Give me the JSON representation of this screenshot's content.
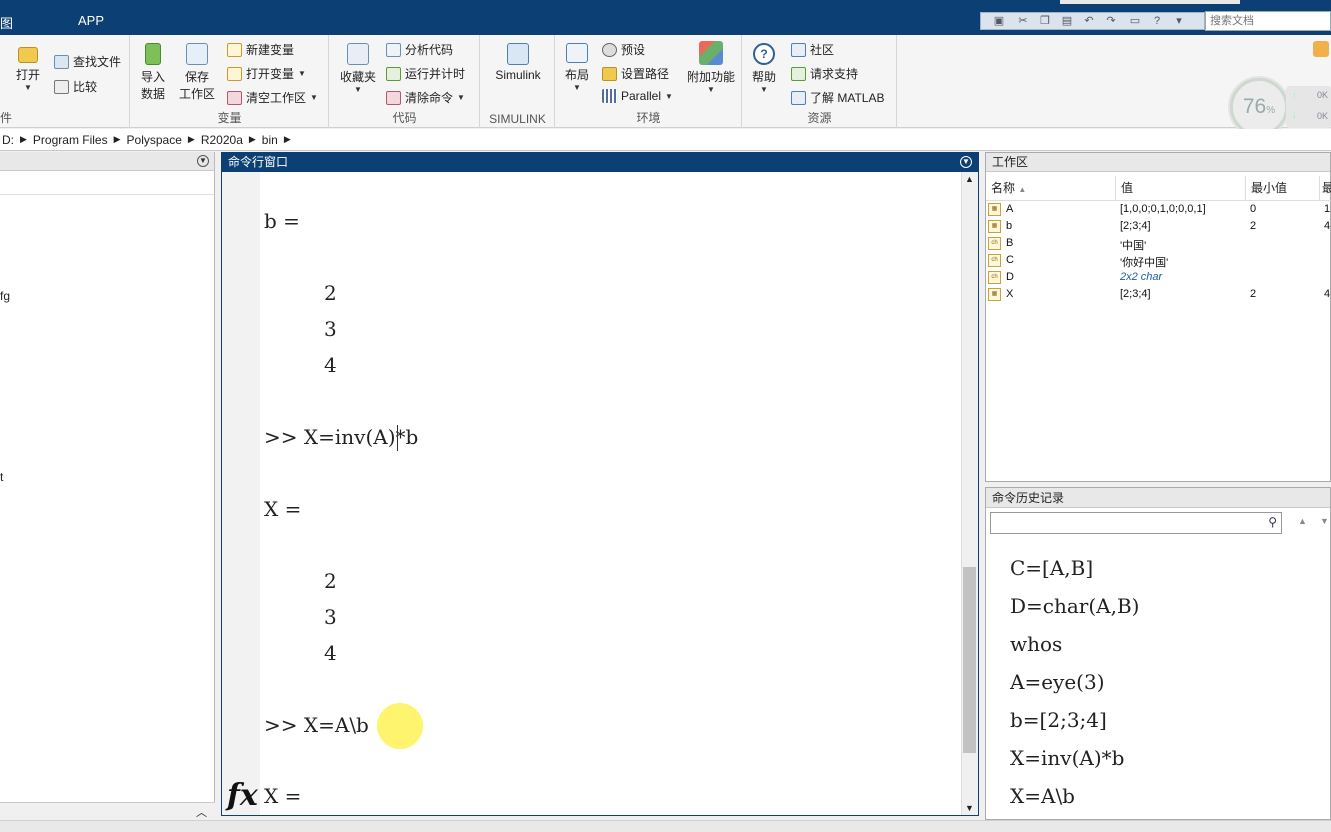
{
  "tabs": {
    "t1": "图",
    "t2": "APP"
  },
  "search_doc": {
    "placeholder": "搜索文档"
  },
  "ribbon": {
    "file_group": {
      "open": "打开",
      "find_files": "查找文件",
      "compare": "比较",
      "label": "件"
    },
    "variable_group": {
      "import": "导入\n数据",
      "import_l1": "导入",
      "import_l2": "数据",
      "save_l1": "保存",
      "save_l2": "工作区",
      "new_var": "新建变量",
      "open_var": "打开变量",
      "clear_ws": "清空工作区",
      "label": "变量"
    },
    "code_group": {
      "favorites": "收藏夹",
      "analyze": "分析代码",
      "run_time": "运行并计时",
      "clear_cmd": "清除命令",
      "label": "代码"
    },
    "simulink_group": {
      "simulink": "Simulink",
      "label": "SIMULINK"
    },
    "env_group": {
      "layout": "布局",
      "preferences": "预设",
      "set_path": "设置路径",
      "parallel": "Parallel",
      "addons": "附加功能",
      "label": "环境"
    },
    "resources_group": {
      "help": "帮助",
      "community": "社区",
      "request_support": "请求支持",
      "learn_matlab": "了解 MATLAB",
      "label": "资源"
    }
  },
  "gauge": {
    "value": "76",
    "unit": "%"
  },
  "netbox": {
    "up": "0K",
    "down": "0K"
  },
  "address": {
    "segments": [
      "D:",
      "Program Files",
      "Polyspace",
      "R2020a",
      "bin"
    ]
  },
  "left_panel": {
    "items": [
      "fg",
      "t"
    ]
  },
  "command_window": {
    "title": "命令行窗口",
    "lines": [
      {
        "text": "b ="
      },
      {
        "text": "2"
      },
      {
        "text": "3"
      },
      {
        "text": "4"
      },
      {
        "text": ">> X=inv(A)*b"
      },
      {
        "text": "X ="
      },
      {
        "text": "2"
      },
      {
        "text": "3"
      },
      {
        "text": "4"
      },
      {
        "text": ">> X=A\\b"
      },
      {
        "text": "X ="
      }
    ],
    "fx_label": "fx"
  },
  "workspace": {
    "title": "工作区",
    "columns": [
      "名称",
      "值",
      "最小值",
      "最"
    ],
    "rows": [
      {
        "name": "A",
        "value": "[1,0,0;0,1,0;0,0,1]",
        "min": "0",
        "max": "1",
        "icon": "matrix-icon"
      },
      {
        "name": "b",
        "value": "[2;3;4]",
        "min": "2",
        "max": "4",
        "icon": "matrix-icon"
      },
      {
        "name": "B",
        "value": "'中国'",
        "min": "",
        "max": "",
        "icon": "char-icon"
      },
      {
        "name": "C",
        "value": "'你好中国'",
        "min": "",
        "max": "",
        "icon": "char-icon"
      },
      {
        "name": "D",
        "value": "2x2 char",
        "min": "",
        "max": "",
        "icon": "char-icon"
      },
      {
        "name": "X",
        "value": "[2;3;4]",
        "min": "2",
        "max": "4",
        "icon": "matrix-icon"
      }
    ]
  },
  "history": {
    "title": "命令历史记录",
    "items": [
      "C=[A,B]",
      "D=char(A,B)",
      "whos",
      "A=eye(3)",
      "b=[2;3;4]",
      "X=inv(A)*b",
      "X=A\\b"
    ]
  }
}
